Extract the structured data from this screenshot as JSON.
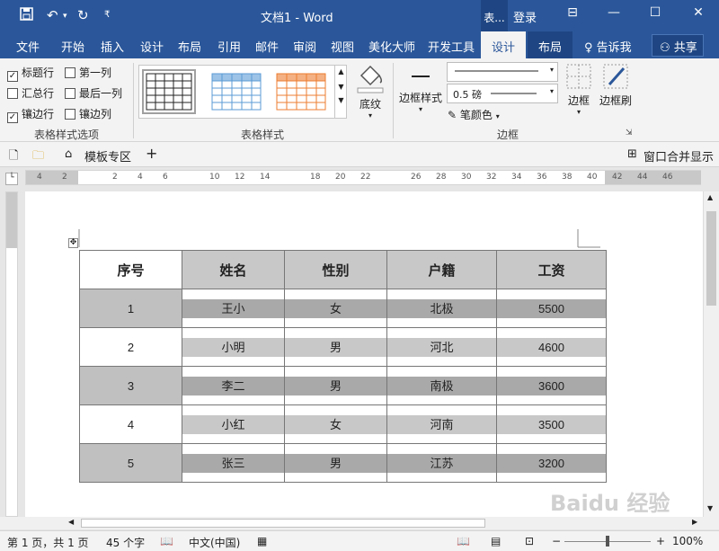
{
  "titlebar": {
    "doc_title": "文档1  -  Word",
    "context_label": "表...",
    "login": "登录",
    "save_icon": "save-icon",
    "undo_icon": "undo-icon",
    "redo_icon": "redo-icon"
  },
  "tabs": [
    "文件",
    "开始",
    "插入",
    "设计",
    "布局",
    "引用",
    "邮件",
    "审阅",
    "视图",
    "美化大师",
    "开发工具"
  ],
  "context_tabs": {
    "design": "设计",
    "layout": "布局"
  },
  "tell_me": "告诉我",
  "share": "共享",
  "ribbon": {
    "options": [
      {
        "label": "标题行",
        "checked": true
      },
      {
        "label": "第一列",
        "checked": false
      },
      {
        "label": "汇总行",
        "checked": false
      },
      {
        "label": "最后一列",
        "checked": false
      },
      {
        "label": "镶边行",
        "checked": true
      },
      {
        "label": "镶边列",
        "checked": false
      }
    ],
    "group_options": "表格样式选项",
    "group_styles": "表格样式",
    "shading": "底纹",
    "border_styles": "边框样式",
    "pen_weight": "0.5 磅",
    "pen_color": "笔颜色",
    "borders": "边框",
    "border_painter": "边框刷",
    "group_borders": "边框"
  },
  "docbar": {
    "template": "模板专区",
    "merge_window": "窗口合并显示"
  },
  "table": {
    "headers": [
      "序号",
      "姓名",
      "性别",
      "户籍",
      "工资"
    ],
    "rows": [
      [
        "1",
        "王小",
        "女",
        "北极",
        "5500"
      ],
      [
        "2",
        "小明",
        "男",
        "河北",
        "4600"
      ],
      [
        "3",
        "李二",
        "男",
        "南极",
        "3600"
      ],
      [
        "4",
        "小红",
        "女",
        "河南",
        "3500"
      ],
      [
        "5",
        "张三",
        "男",
        "江苏",
        "3200"
      ]
    ]
  },
  "statusbar": {
    "page": "第 1 页，共 1 页",
    "words": "45 个字",
    "language": "中文(中国)",
    "zoom": "100%"
  },
  "ruler_numbers": [
    "4",
    "2",
    "2",
    "4",
    "6",
    "10",
    "12",
    "14",
    "18",
    "20",
    "22",
    "26",
    "28",
    "30",
    "32",
    "34",
    "36",
    "38",
    "40",
    "42",
    "44",
    "46"
  ],
  "watermark": "Baidu 经验"
}
